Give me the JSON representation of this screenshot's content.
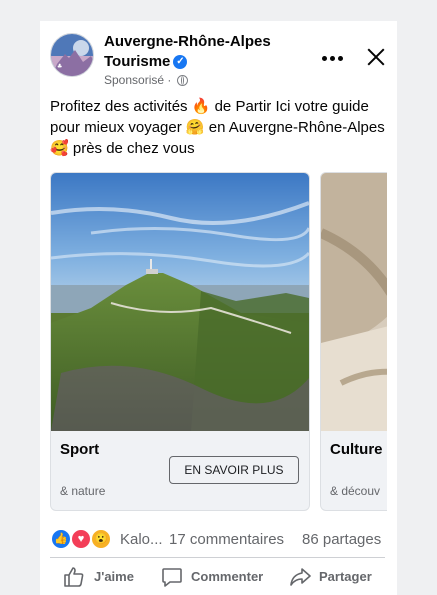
{
  "post": {
    "page_name": "Auvergne-Rhône-Alpes Tourisme",
    "sponsored": "Sponsorisé",
    "sponsored_sep": " · ",
    "text_parts": [
      "Profitez des activités ",
      " de Partir Ici votre guide pour mieux voyager ",
      " en Auvergne-Rhône-Alpes ",
      " près de chez vous"
    ],
    "emojis": [
      "🔥",
      "🤗",
      "🥰"
    ]
  },
  "carousel": {
    "items": [
      {
        "title": "Sport",
        "description": "& nature",
        "cta": "EN SAVOIR PLUS",
        "image": "volcano-landscape"
      },
      {
        "title": "Culture",
        "description": "& découv",
        "cta": "",
        "image": "architecture-staircase"
      }
    ]
  },
  "engagement": {
    "reaction_icons": [
      "like-icon",
      "love-icon",
      "wow-icon"
    ],
    "reactors": "Kalo...",
    "comments": "17 commentaires",
    "shares": "86 partages"
  },
  "actions": {
    "like": "J'aime",
    "comment": "Commenter",
    "share": "Partager"
  },
  "colors": {
    "accent": "#1877f2",
    "love": "#f33e58",
    "wow": "#f7b125",
    "background": "#eff0f2"
  }
}
